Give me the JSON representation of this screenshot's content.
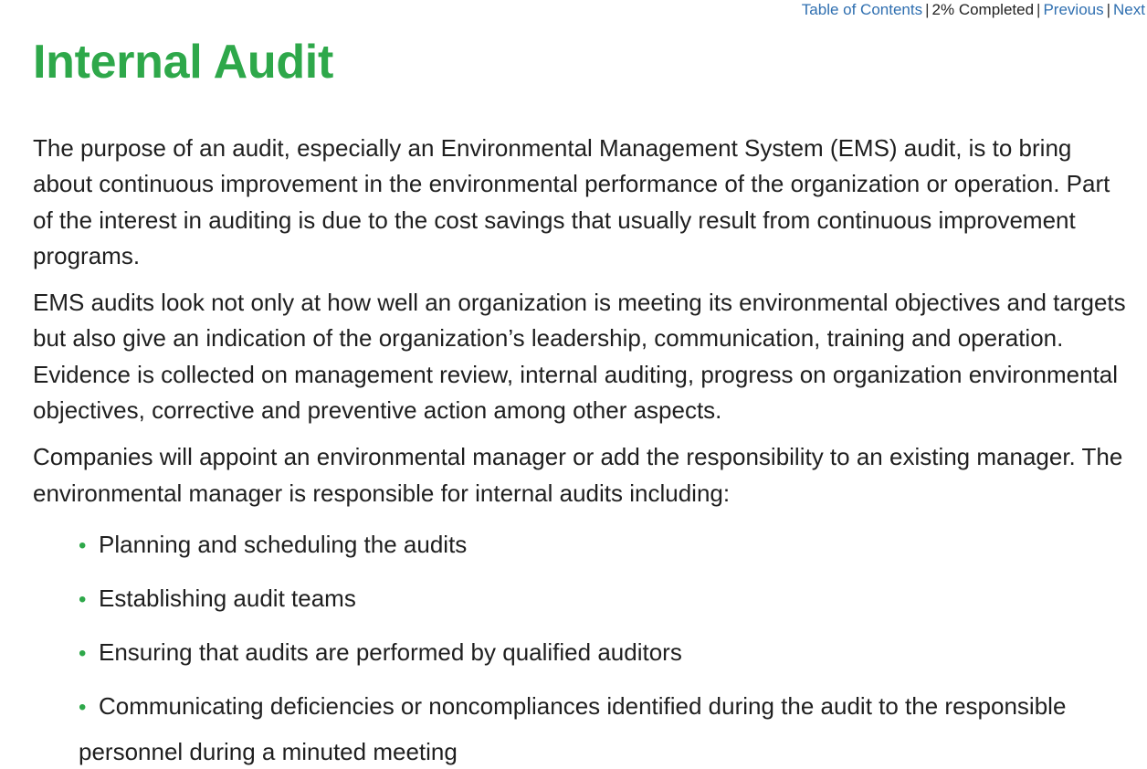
{
  "nav": {
    "toc_label": "Table of Contents",
    "progress": "2% Completed",
    "previous_label": "Previous",
    "next_label": "Next",
    "separator": "|"
  },
  "page": {
    "title": "Internal Audit",
    "paragraphs": [
      "The purpose of an audit, especially an Environmental Management System (EMS) audit, is to bring about continuous improvement in the environmental performance of the organization or operation. Part of the interest in auditing is due to the cost savings that usually result from continuous improvement programs.",
      "EMS audits look not only at how well an organization is meeting its environmental objectives and targets but also give an indication of the organization’s leadership, communication, training and operation. Evidence is collected on management review, internal auditing, progress on organization environmental objectives, corrective and preventive action among other aspects.",
      "Companies will appoint an environmental manager or add the responsibility to an existing manager. The environmental manager is responsible for internal audits including:"
    ],
    "bullet_glyph": "•",
    "bullets": [
      "Planning and scheduling the audits",
      "Establishing audit teams",
      "Ensuring that audits are performed by qualified auditors",
      "Communicating deficiencies or noncompliances identified during the audit to the responsible personnel during a minuted meeting"
    ]
  },
  "colors": {
    "title": "#2ea84a",
    "link": "#2f6fb0",
    "body_text": "#1f1f1f",
    "bullet": "#2ea84a"
  }
}
